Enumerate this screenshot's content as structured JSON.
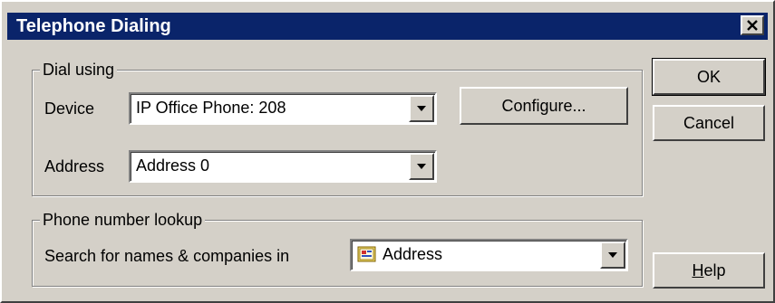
{
  "window": {
    "title": "Telephone Dialing"
  },
  "dial_using": {
    "legend": "Dial using",
    "device_label": "Device",
    "device_value": "IP Office Phone: 208",
    "configure_label": "Configure...",
    "address_label": "Address",
    "address_value": "Address 0"
  },
  "lookup": {
    "legend": "Phone number lookup",
    "search_label": "Search for names & companies in",
    "search_value": "Address"
  },
  "buttons": {
    "ok": "OK",
    "cancel": "Cancel",
    "help_rest": "elp",
    "help_access": "H"
  },
  "icons": {
    "close": "close-icon",
    "dropdown": "chevron-down-icon",
    "address_book": "address-book-icon"
  }
}
